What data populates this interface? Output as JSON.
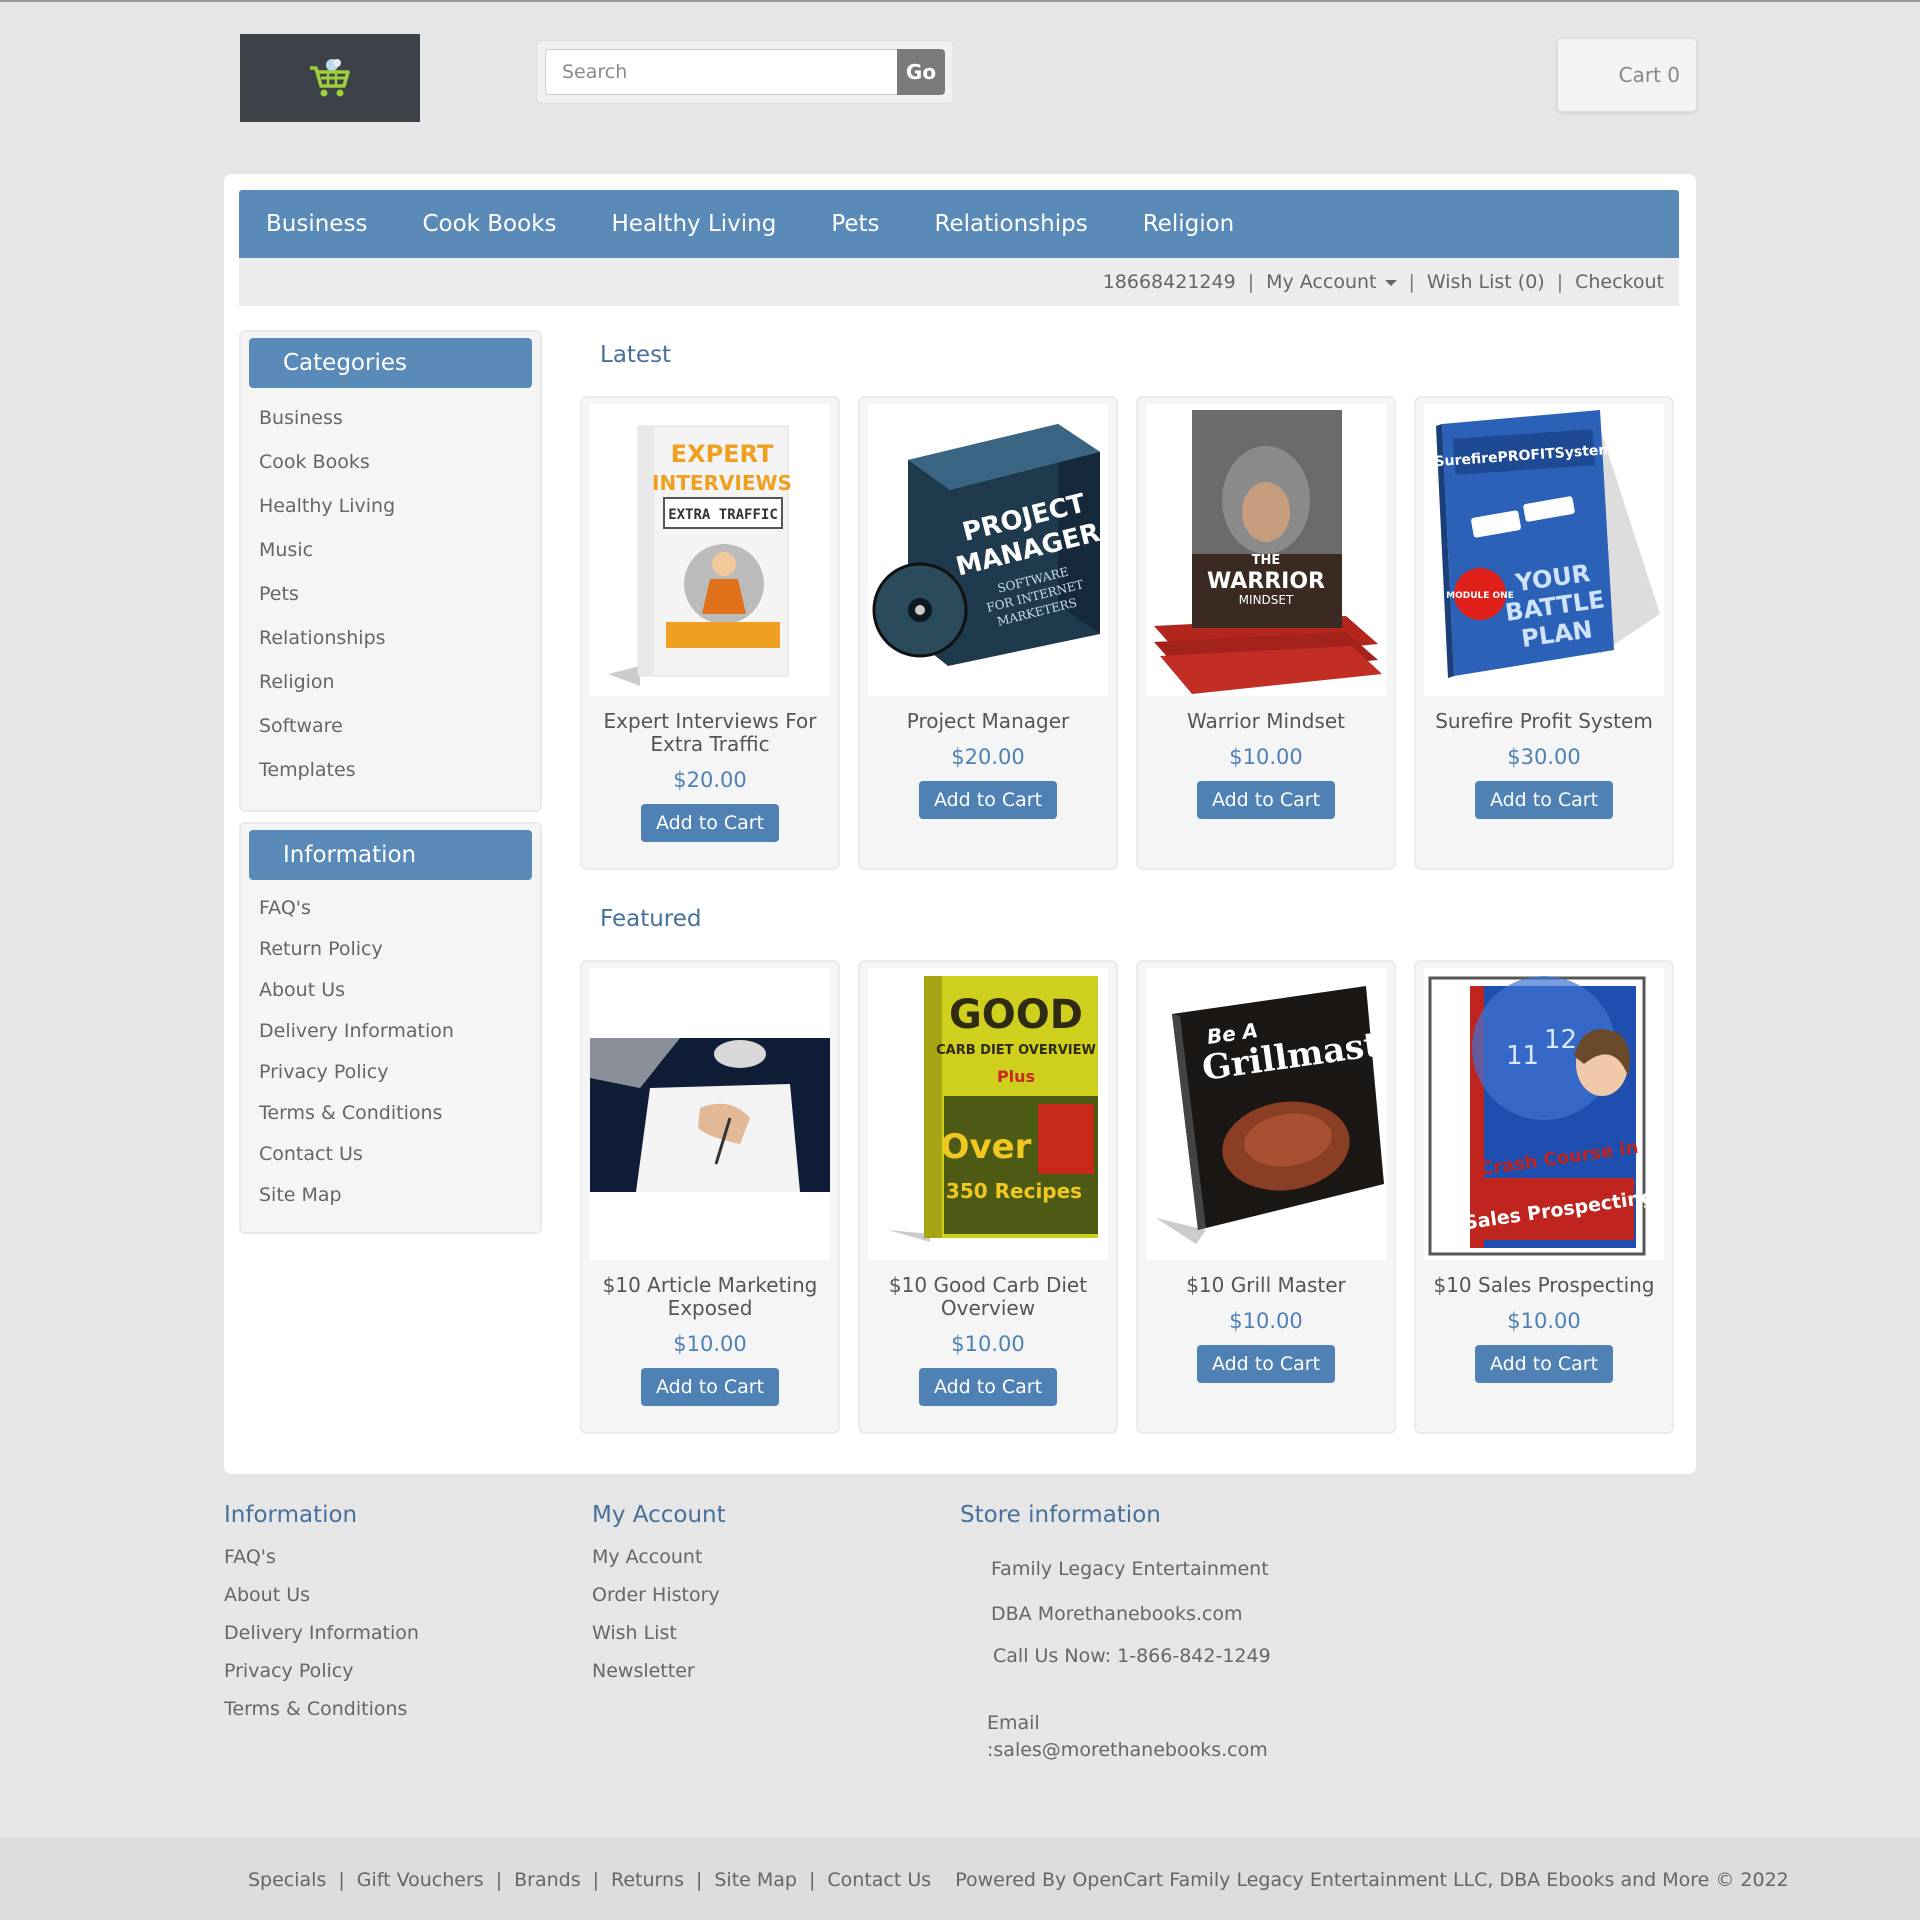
{
  "header": {
    "logo_icon": "shopping-cart-icon",
    "search": {
      "placeholder": "Search",
      "value": ""
    },
    "go_label": "Go",
    "cart_label": "Cart 0"
  },
  "topnav": [
    "Business",
    "Cook Books",
    "Healthy Living",
    "Pets",
    "Relationships",
    "Religion"
  ],
  "subnav": {
    "phone": "18668421249",
    "my_account": "My Account",
    "wish_list": "Wish List (0)",
    "checkout": "Checkout"
  },
  "sidebar": {
    "categories_title": "Categories",
    "categories": [
      "Business",
      "Cook Books",
      "Healthy Living",
      "Music",
      "Pets",
      "Relationships",
      "Religion",
      "Software",
      "Templates"
    ],
    "information_title": "Information",
    "information": [
      "FAQ's",
      "Return Policy",
      "About Us",
      "Delivery Information",
      "Privacy Policy",
      "Terms & Conditions",
      "Contact Us",
      "Site Map"
    ]
  },
  "latest": {
    "title": "Latest",
    "products": [
      {
        "name": "Expert Interviews For Extra Traffic",
        "price": "$20.00",
        "button": "Add to Cart"
      },
      {
        "name": "Project Manager",
        "price": "$20.00",
        "button": "Add to Cart"
      },
      {
        "name": "Warrior Mindset",
        "price": "$10.00",
        "button": "Add to Cart"
      },
      {
        "name": "Surefire Profit System",
        "price": "$30.00",
        "button": "Add to Cart"
      }
    ]
  },
  "featured": {
    "title": "Featured",
    "products": [
      {
        "name": "$10 Article Marketing Exposed",
        "price": "$10.00",
        "button": "Add to Cart"
      },
      {
        "name": "$10 Good Carb Diet Overview",
        "price": "$10.00",
        "button": "Add to Cart"
      },
      {
        "name": "$10 Grill Master",
        "price": "$10.00",
        "button": "Add to Cart"
      },
      {
        "name": "$10 Sales Prospecting",
        "price": "$10.00",
        "button": "Add to Cart"
      }
    ]
  },
  "covers": {
    "expert": {
      "line1": "EXPERT",
      "line2": "INTERVIEWS",
      "line3": "EXTRA TRAFFIC"
    },
    "pm": {
      "line1": "PROJECT",
      "line2": "MANAGER",
      "line3": "SOFTWARE",
      "line4": "FOR INTERNET",
      "line5": "MARKETERS"
    },
    "warrior": {
      "line1": "THE",
      "line2": "WARRIOR",
      "line3": "MINDSET"
    },
    "surefire": {
      "line1": "SurefirePROFITSystem",
      "line2": "YOUR",
      "line3": "BATTLE",
      "line4": "PLAN",
      "badge": "MODULE ONE"
    },
    "carb": {
      "line1": "GOOD",
      "line2": "CARB DIET OVERVIEW",
      "line3": "Plus",
      "line4": "Over",
      "line5": "350 Recipes"
    },
    "grill": {
      "line1": "Be A",
      "line2": "Grillmaster"
    },
    "sales": {
      "line1": "11",
      "line2": "12",
      "line3": "Crash Course in",
      "line4": "Sales Prospecting"
    }
  },
  "footer": {
    "information": {
      "title": "Information",
      "links": [
        "FAQ's",
        "About Us",
        "Delivery Information",
        "Privacy Policy",
        "Terms & Conditions"
      ]
    },
    "my_account": {
      "title": "My Account",
      "links": [
        "My Account",
        "Order History",
        "Wish List",
        "Newsletter"
      ]
    },
    "store": {
      "title": "Store information",
      "name": "Family Legacy Entertainment",
      "dba": "DBA Morethanebooks.com",
      "phone": "Call Us Now: 1-866-842-1249",
      "email_label": "Email",
      "email": ":sales@morethanebooks.com"
    },
    "bottom_links": [
      "Specials",
      "Gift Vouchers",
      "Brands",
      "Returns",
      "Site Map",
      "Contact Us"
    ],
    "powered": "Powered By OpenCart Family Legacy Entertainment LLC, DBA Ebooks and More © 2022"
  },
  "colors": {
    "accent": "#5a8ab8",
    "price": "#4f81b5",
    "heading": "#47709a",
    "page_bg": "#e6e6e6"
  }
}
